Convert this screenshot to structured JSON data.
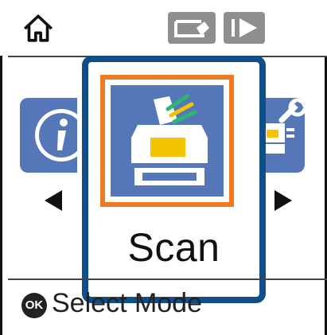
{
  "top_bar": {
    "home_icon": "home-icon",
    "status_icons": [
      "scanner-status-icon",
      "play-status-icon"
    ]
  },
  "carousel": {
    "left_item_icon": "info-icon",
    "selected": {
      "label": "Scan",
      "icon": "scanner-icon"
    },
    "right_item_icon": "scanner-settings-icon",
    "left_arrow": "left-arrow-icon",
    "right_arrow": "right-arrow-icon"
  },
  "footer": {
    "ok_badge": "OK",
    "hint": "Select Mode"
  },
  "colors": {
    "tile_blue": "#5577b7",
    "frame_navy": "#0f4f87",
    "highlight_orange": "#f07a21"
  }
}
